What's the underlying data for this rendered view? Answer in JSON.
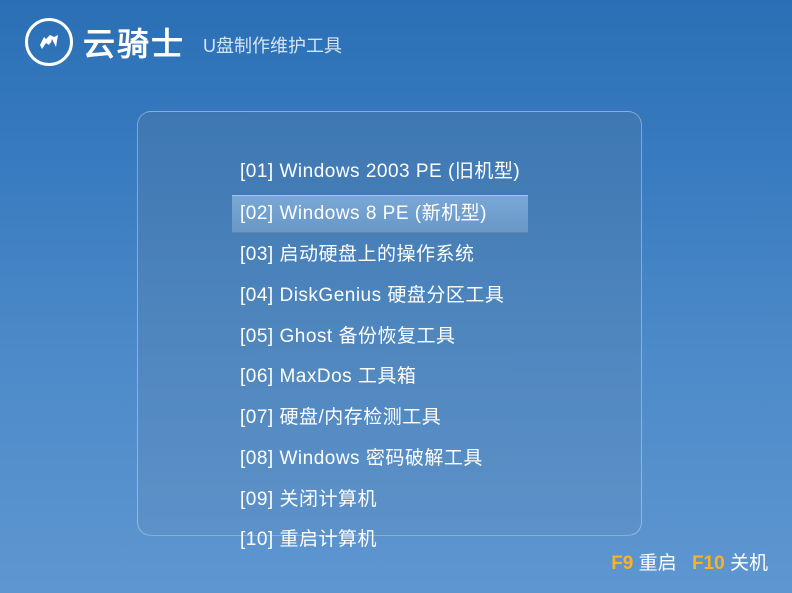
{
  "header": {
    "brand": "云骑士",
    "subtitle": "U盘制作维护工具"
  },
  "menu": {
    "selected_index": 1,
    "items": [
      "[01] Windows 2003 PE (旧机型)",
      "[02] Windows 8 PE (新机型)",
      "[03] 启动硬盘上的操作系统",
      "[04] DiskGenius 硬盘分区工具",
      "[05] Ghost 备份恢复工具",
      "[06] MaxDos 工具箱",
      "[07] 硬盘/内存检测工具",
      "[08] Windows 密码破解工具",
      "[09] 关闭计算机",
      "[10] 重启计算机"
    ]
  },
  "footer": {
    "f9_key": "F9",
    "f9_label": "重启",
    "f10_key": "F10",
    "f10_label": "关机"
  }
}
